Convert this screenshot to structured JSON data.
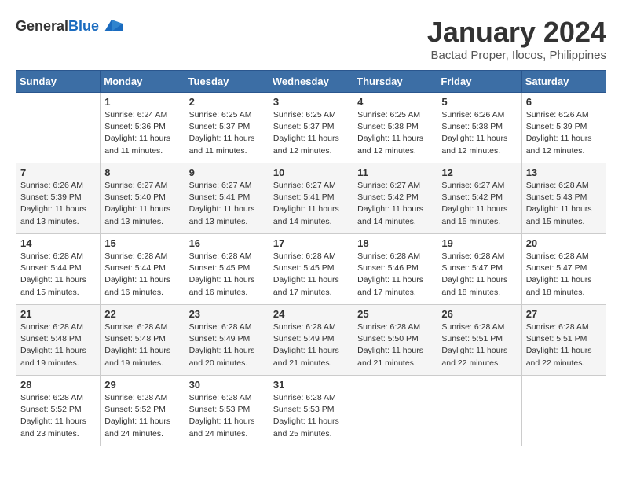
{
  "logo": {
    "general": "General",
    "blue": "Blue"
  },
  "header": {
    "month": "January 2024",
    "location": "Bactad Proper, Ilocos, Philippines"
  },
  "weekdays": [
    "Sunday",
    "Monday",
    "Tuesday",
    "Wednesday",
    "Thursday",
    "Friday",
    "Saturday"
  ],
  "weeks": [
    [
      {
        "day": "",
        "sunrise": "",
        "sunset": "",
        "daylight": ""
      },
      {
        "day": "1",
        "sunrise": "Sunrise: 6:24 AM",
        "sunset": "Sunset: 5:36 PM",
        "daylight": "Daylight: 11 hours and 11 minutes."
      },
      {
        "day": "2",
        "sunrise": "Sunrise: 6:25 AM",
        "sunset": "Sunset: 5:37 PM",
        "daylight": "Daylight: 11 hours and 11 minutes."
      },
      {
        "day": "3",
        "sunrise": "Sunrise: 6:25 AM",
        "sunset": "Sunset: 5:37 PM",
        "daylight": "Daylight: 11 hours and 12 minutes."
      },
      {
        "day": "4",
        "sunrise": "Sunrise: 6:25 AM",
        "sunset": "Sunset: 5:38 PM",
        "daylight": "Daylight: 11 hours and 12 minutes."
      },
      {
        "day": "5",
        "sunrise": "Sunrise: 6:26 AM",
        "sunset": "Sunset: 5:38 PM",
        "daylight": "Daylight: 11 hours and 12 minutes."
      },
      {
        "day": "6",
        "sunrise": "Sunrise: 6:26 AM",
        "sunset": "Sunset: 5:39 PM",
        "daylight": "Daylight: 11 hours and 12 minutes."
      }
    ],
    [
      {
        "day": "7",
        "sunrise": "Sunrise: 6:26 AM",
        "sunset": "Sunset: 5:39 PM",
        "daylight": "Daylight: 11 hours and 13 minutes."
      },
      {
        "day": "8",
        "sunrise": "Sunrise: 6:27 AM",
        "sunset": "Sunset: 5:40 PM",
        "daylight": "Daylight: 11 hours and 13 minutes."
      },
      {
        "day": "9",
        "sunrise": "Sunrise: 6:27 AM",
        "sunset": "Sunset: 5:41 PM",
        "daylight": "Daylight: 11 hours and 13 minutes."
      },
      {
        "day": "10",
        "sunrise": "Sunrise: 6:27 AM",
        "sunset": "Sunset: 5:41 PM",
        "daylight": "Daylight: 11 hours and 14 minutes."
      },
      {
        "day": "11",
        "sunrise": "Sunrise: 6:27 AM",
        "sunset": "Sunset: 5:42 PM",
        "daylight": "Daylight: 11 hours and 14 minutes."
      },
      {
        "day": "12",
        "sunrise": "Sunrise: 6:27 AM",
        "sunset": "Sunset: 5:42 PM",
        "daylight": "Daylight: 11 hours and 15 minutes."
      },
      {
        "day": "13",
        "sunrise": "Sunrise: 6:28 AM",
        "sunset": "Sunset: 5:43 PM",
        "daylight": "Daylight: 11 hours and 15 minutes."
      }
    ],
    [
      {
        "day": "14",
        "sunrise": "Sunrise: 6:28 AM",
        "sunset": "Sunset: 5:44 PM",
        "daylight": "Daylight: 11 hours and 15 minutes."
      },
      {
        "day": "15",
        "sunrise": "Sunrise: 6:28 AM",
        "sunset": "Sunset: 5:44 PM",
        "daylight": "Daylight: 11 hours and 16 minutes."
      },
      {
        "day": "16",
        "sunrise": "Sunrise: 6:28 AM",
        "sunset": "Sunset: 5:45 PM",
        "daylight": "Daylight: 11 hours and 16 minutes."
      },
      {
        "day": "17",
        "sunrise": "Sunrise: 6:28 AM",
        "sunset": "Sunset: 5:45 PM",
        "daylight": "Daylight: 11 hours and 17 minutes."
      },
      {
        "day": "18",
        "sunrise": "Sunrise: 6:28 AM",
        "sunset": "Sunset: 5:46 PM",
        "daylight": "Daylight: 11 hours and 17 minutes."
      },
      {
        "day": "19",
        "sunrise": "Sunrise: 6:28 AM",
        "sunset": "Sunset: 5:47 PM",
        "daylight": "Daylight: 11 hours and 18 minutes."
      },
      {
        "day": "20",
        "sunrise": "Sunrise: 6:28 AM",
        "sunset": "Sunset: 5:47 PM",
        "daylight": "Daylight: 11 hours and 18 minutes."
      }
    ],
    [
      {
        "day": "21",
        "sunrise": "Sunrise: 6:28 AM",
        "sunset": "Sunset: 5:48 PM",
        "daylight": "Daylight: 11 hours and 19 minutes."
      },
      {
        "day": "22",
        "sunrise": "Sunrise: 6:28 AM",
        "sunset": "Sunset: 5:48 PM",
        "daylight": "Daylight: 11 hours and 19 minutes."
      },
      {
        "day": "23",
        "sunrise": "Sunrise: 6:28 AM",
        "sunset": "Sunset: 5:49 PM",
        "daylight": "Daylight: 11 hours and 20 minutes."
      },
      {
        "day": "24",
        "sunrise": "Sunrise: 6:28 AM",
        "sunset": "Sunset: 5:49 PM",
        "daylight": "Daylight: 11 hours and 21 minutes."
      },
      {
        "day": "25",
        "sunrise": "Sunrise: 6:28 AM",
        "sunset": "Sunset: 5:50 PM",
        "daylight": "Daylight: 11 hours and 21 minutes."
      },
      {
        "day": "26",
        "sunrise": "Sunrise: 6:28 AM",
        "sunset": "Sunset: 5:51 PM",
        "daylight": "Daylight: 11 hours and 22 minutes."
      },
      {
        "day": "27",
        "sunrise": "Sunrise: 6:28 AM",
        "sunset": "Sunset: 5:51 PM",
        "daylight": "Daylight: 11 hours and 22 minutes."
      }
    ],
    [
      {
        "day": "28",
        "sunrise": "Sunrise: 6:28 AM",
        "sunset": "Sunset: 5:52 PM",
        "daylight": "Daylight: 11 hours and 23 minutes."
      },
      {
        "day": "29",
        "sunrise": "Sunrise: 6:28 AM",
        "sunset": "Sunset: 5:52 PM",
        "daylight": "Daylight: 11 hours and 24 minutes."
      },
      {
        "day": "30",
        "sunrise": "Sunrise: 6:28 AM",
        "sunset": "Sunset: 5:53 PM",
        "daylight": "Daylight: 11 hours and 24 minutes."
      },
      {
        "day": "31",
        "sunrise": "Sunrise: 6:28 AM",
        "sunset": "Sunset: 5:53 PM",
        "daylight": "Daylight: 11 hours and 25 minutes."
      },
      {
        "day": "",
        "sunrise": "",
        "sunset": "",
        "daylight": ""
      },
      {
        "day": "",
        "sunrise": "",
        "sunset": "",
        "daylight": ""
      },
      {
        "day": "",
        "sunrise": "",
        "sunset": "",
        "daylight": ""
      }
    ]
  ]
}
